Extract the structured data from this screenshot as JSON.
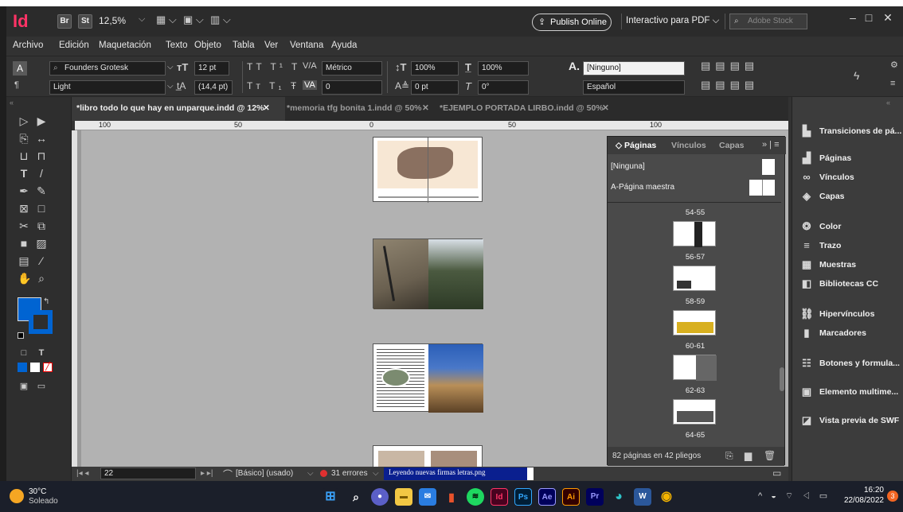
{
  "app": {
    "logo": "Id",
    "bridge": "Br",
    "stock": "St",
    "zoom": "12,5%",
    "publish_online": "Publish Online",
    "workspace": "Interactivo para PDF",
    "search_placeholder": "Adobe Stock"
  },
  "menu": [
    "Archivo",
    "Edición",
    "Maquetación",
    "Texto",
    "Objeto",
    "Tabla",
    "Ver",
    "Ventana",
    "Ayuda"
  ],
  "control": {
    "font_family": "Founders Grotesk",
    "font_style": "Light",
    "font_size": "12 pt",
    "leading": "(14,4 pt)",
    "kerning": "Métrico",
    "tracking": "0",
    "vscale": "100%",
    "hscale": "100%",
    "baseline": "0 pt",
    "skew": "0°",
    "char_style": "[Ninguno]",
    "language": "Español"
  },
  "tabs": [
    {
      "label": "*libro todo lo que hay en unparque.indd @ 12%"
    },
    {
      "label": "*memoria tfg bonita 1.indd @ 50%"
    },
    {
      "label": "*EJEMPLO PORTADA LIRBO.indd @ 50%"
    }
  ],
  "ruler": {
    "marks": [
      "100",
      "50",
      "0",
      "50",
      "100"
    ]
  },
  "pages_panel": {
    "tabs": [
      "Páginas",
      "Vínculos",
      "Capas"
    ],
    "masters": [
      "[Ninguna]",
      "A-Página maestra"
    ],
    "spreads": [
      "54-55",
      "56-57",
      "58-59",
      "60-61",
      "62-63",
      "64-65"
    ],
    "footer": "82 páginas en 42 pliegos"
  },
  "status": {
    "page": "22",
    "style": "[Básico] (usado)",
    "errors": "31 errores",
    "progress_label": "Leyendo nuevas firmas letras.png",
    "progress": 0.96
  },
  "dock": [
    {
      "label": "Transiciones de pá...",
      "icon": "transitions-icon"
    },
    {
      "label": "Páginas",
      "icon": "pages-icon"
    },
    {
      "label": "Vínculos",
      "icon": "links-icon"
    },
    {
      "label": "Capas",
      "icon": "layers-icon"
    },
    {
      "label": "Color",
      "icon": "color-icon"
    },
    {
      "label": "Trazo",
      "icon": "stroke-icon"
    },
    {
      "label": "Muestras",
      "icon": "swatches-icon"
    },
    {
      "label": "Bibliotecas CC",
      "icon": "cc-libraries-icon"
    },
    {
      "label": "Hipervínculos",
      "icon": "hyperlinks-icon"
    },
    {
      "label": "Marcadores",
      "icon": "bookmarks-icon"
    },
    {
      "label": "Botones y formula...",
      "icon": "buttons-icon"
    },
    {
      "label": "Elemento multime...",
      "icon": "media-icon"
    },
    {
      "label": "Vista previa de SWF",
      "icon": "swf-preview-icon"
    }
  ],
  "taskbar": {
    "temp": "30°C",
    "weather": "Soleado",
    "time": "16:20",
    "date": "22/08/2022",
    "notif": "3"
  },
  "colors": {
    "accent": "#0064d2",
    "id_pink": "#ff3366"
  }
}
